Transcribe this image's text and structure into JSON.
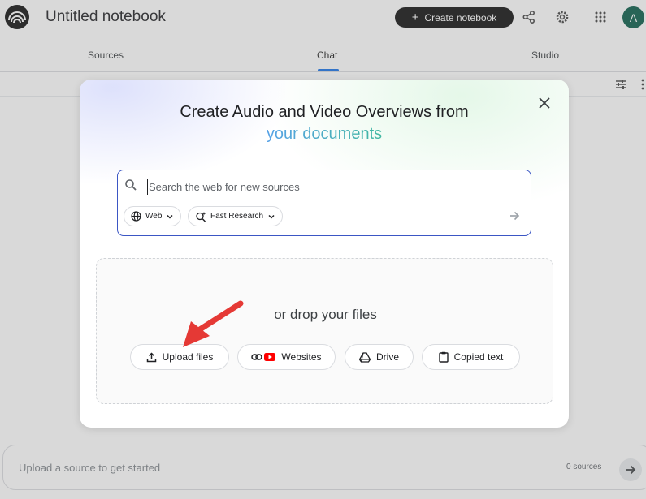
{
  "header": {
    "notebook_title": "Untitled notebook",
    "create_button_label": "Create notebook",
    "avatar_letter": "A"
  },
  "tabs": [
    {
      "label": "Sources"
    },
    {
      "label": "Chat",
      "active": true
    },
    {
      "label": "Studio"
    }
  ],
  "bottom_bar": {
    "placeholder": "Upload a source to get started",
    "sources_count": "0 sources"
  },
  "dialog": {
    "title_line1": "Create Audio and Video Overviews from",
    "title_line2": "your documents",
    "search": {
      "placeholder": "Search the web for new sources",
      "source_chip": "Web",
      "mode_chip": "Fast Research"
    },
    "drop_zone": {
      "text": "or drop your files",
      "buttons": [
        {
          "label": "Upload files",
          "icon": "upload-icon"
        },
        {
          "label": "Websites",
          "icon": "link-youtube-icon"
        },
        {
          "label": "Drive",
          "icon": "drive-icon"
        },
        {
          "label": "Copied text",
          "icon": "clipboard-icon"
        }
      ]
    }
  },
  "colors": {
    "accent_blue": "#1a73e8",
    "search_border": "#3b56c4",
    "annotation_red": "#e53935",
    "avatar_green": "#0b5e4a"
  }
}
